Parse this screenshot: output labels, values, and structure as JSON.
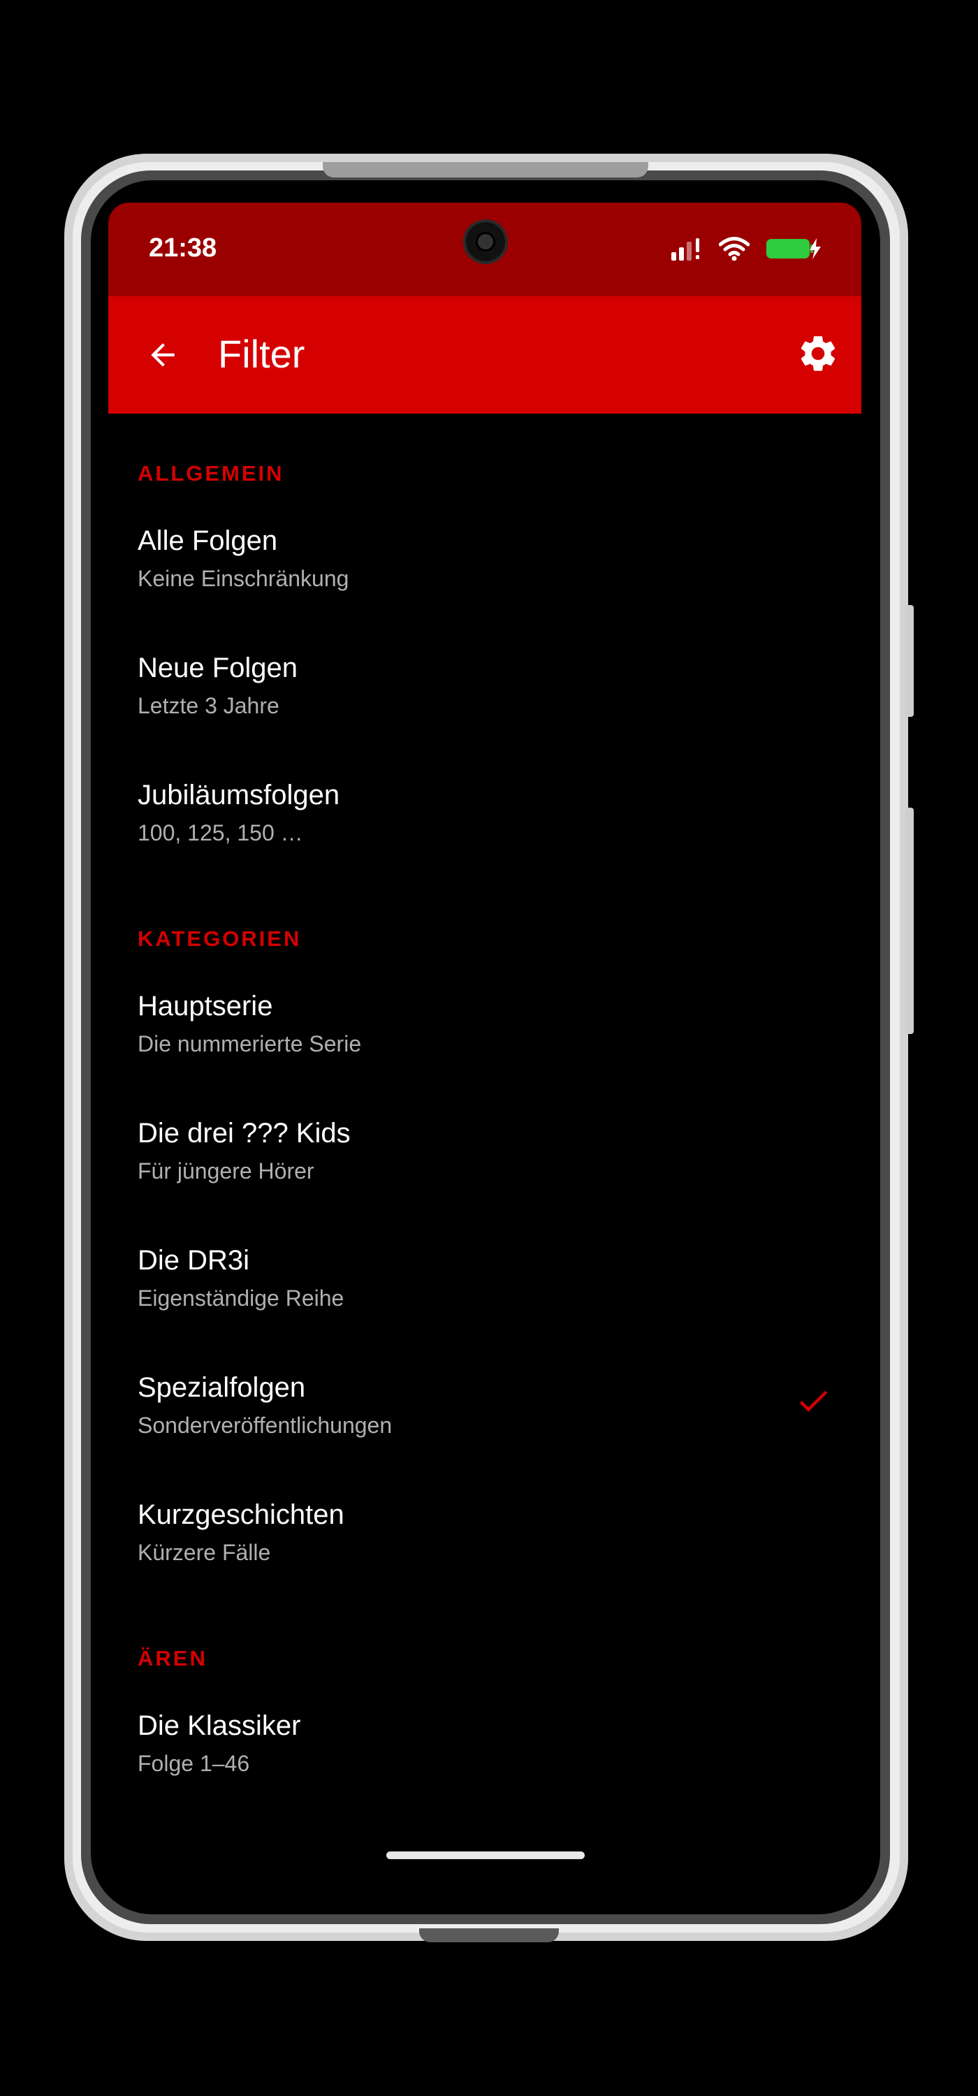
{
  "status_bar": {
    "time": "21:38"
  },
  "app_bar": {
    "title": "Filter"
  },
  "colors": {
    "accent": "#d50000",
    "status_bar": "#9b0000",
    "subtitle": "#b0b0b0"
  },
  "sections": [
    {
      "header": "ALLGEMEIN",
      "items": [
        {
          "title": "Alle Folgen",
          "subtitle": "Keine Einschränkung",
          "checked": false
        },
        {
          "title": "Neue Folgen",
          "subtitle": "Letzte 3 Jahre",
          "checked": false
        },
        {
          "title": "Jubiläumsfolgen",
          "subtitle": "100, 125, 150 …",
          "checked": false
        }
      ]
    },
    {
      "header": "KATEGORIEN",
      "items": [
        {
          "title": "Hauptserie",
          "subtitle": "Die nummerierte Serie",
          "checked": false
        },
        {
          "title": "Die drei ??? Kids",
          "subtitle": "Für jüngere Hörer",
          "checked": false
        },
        {
          "title": "Die DR3i",
          "subtitle": "Eigenständige Reihe",
          "checked": false
        },
        {
          "title": "Spezialfolgen",
          "subtitle": "Sonderveröffentlichungen",
          "checked": true
        },
        {
          "title": "Kurzgeschichten",
          "subtitle": "Kürzere Fälle",
          "checked": false
        }
      ]
    },
    {
      "header": "ÄREN",
      "items": [
        {
          "title": "Die Klassiker",
          "subtitle": "Folge 1–46",
          "checked": false
        }
      ]
    }
  ],
  "icons": {
    "back": "arrow-back-icon",
    "settings": "gear-icon",
    "check": "check-icon",
    "signal": "signal-icon",
    "wifi": "wifi-icon",
    "battery": "battery-charging-icon"
  }
}
